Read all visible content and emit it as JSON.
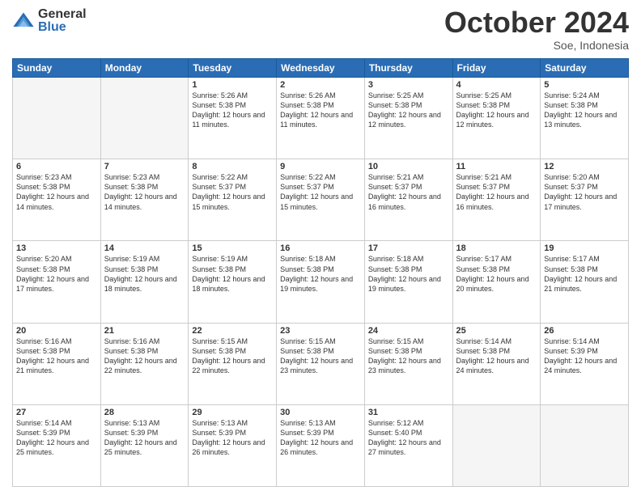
{
  "logo": {
    "general": "General",
    "blue": "Blue"
  },
  "header": {
    "month": "October 2024",
    "location": "Soe, Indonesia"
  },
  "weekdays": [
    "Sunday",
    "Monday",
    "Tuesday",
    "Wednesday",
    "Thursday",
    "Friday",
    "Saturday"
  ],
  "weeks": [
    [
      {
        "day": "",
        "info": ""
      },
      {
        "day": "",
        "info": ""
      },
      {
        "day": "1",
        "info": "Sunrise: 5:26 AM\nSunset: 5:38 PM\nDaylight: 12 hours and 11 minutes."
      },
      {
        "day": "2",
        "info": "Sunrise: 5:26 AM\nSunset: 5:38 PM\nDaylight: 12 hours and 11 minutes."
      },
      {
        "day": "3",
        "info": "Sunrise: 5:25 AM\nSunset: 5:38 PM\nDaylight: 12 hours and 12 minutes."
      },
      {
        "day": "4",
        "info": "Sunrise: 5:25 AM\nSunset: 5:38 PM\nDaylight: 12 hours and 12 minutes."
      },
      {
        "day": "5",
        "info": "Sunrise: 5:24 AM\nSunset: 5:38 PM\nDaylight: 12 hours and 13 minutes."
      }
    ],
    [
      {
        "day": "6",
        "info": "Sunrise: 5:23 AM\nSunset: 5:38 PM\nDaylight: 12 hours and 14 minutes."
      },
      {
        "day": "7",
        "info": "Sunrise: 5:23 AM\nSunset: 5:38 PM\nDaylight: 12 hours and 14 minutes."
      },
      {
        "day": "8",
        "info": "Sunrise: 5:22 AM\nSunset: 5:37 PM\nDaylight: 12 hours and 15 minutes."
      },
      {
        "day": "9",
        "info": "Sunrise: 5:22 AM\nSunset: 5:37 PM\nDaylight: 12 hours and 15 minutes."
      },
      {
        "day": "10",
        "info": "Sunrise: 5:21 AM\nSunset: 5:37 PM\nDaylight: 12 hours and 16 minutes."
      },
      {
        "day": "11",
        "info": "Sunrise: 5:21 AM\nSunset: 5:37 PM\nDaylight: 12 hours and 16 minutes."
      },
      {
        "day": "12",
        "info": "Sunrise: 5:20 AM\nSunset: 5:37 PM\nDaylight: 12 hours and 17 minutes."
      }
    ],
    [
      {
        "day": "13",
        "info": "Sunrise: 5:20 AM\nSunset: 5:38 PM\nDaylight: 12 hours and 17 minutes."
      },
      {
        "day": "14",
        "info": "Sunrise: 5:19 AM\nSunset: 5:38 PM\nDaylight: 12 hours and 18 minutes."
      },
      {
        "day": "15",
        "info": "Sunrise: 5:19 AM\nSunset: 5:38 PM\nDaylight: 12 hours and 18 minutes."
      },
      {
        "day": "16",
        "info": "Sunrise: 5:18 AM\nSunset: 5:38 PM\nDaylight: 12 hours and 19 minutes."
      },
      {
        "day": "17",
        "info": "Sunrise: 5:18 AM\nSunset: 5:38 PM\nDaylight: 12 hours and 19 minutes."
      },
      {
        "day": "18",
        "info": "Sunrise: 5:17 AM\nSunset: 5:38 PM\nDaylight: 12 hours and 20 minutes."
      },
      {
        "day": "19",
        "info": "Sunrise: 5:17 AM\nSunset: 5:38 PM\nDaylight: 12 hours and 21 minutes."
      }
    ],
    [
      {
        "day": "20",
        "info": "Sunrise: 5:16 AM\nSunset: 5:38 PM\nDaylight: 12 hours and 21 minutes."
      },
      {
        "day": "21",
        "info": "Sunrise: 5:16 AM\nSunset: 5:38 PM\nDaylight: 12 hours and 22 minutes."
      },
      {
        "day": "22",
        "info": "Sunrise: 5:15 AM\nSunset: 5:38 PM\nDaylight: 12 hours and 22 minutes."
      },
      {
        "day": "23",
        "info": "Sunrise: 5:15 AM\nSunset: 5:38 PM\nDaylight: 12 hours and 23 minutes."
      },
      {
        "day": "24",
        "info": "Sunrise: 5:15 AM\nSunset: 5:38 PM\nDaylight: 12 hours and 23 minutes."
      },
      {
        "day": "25",
        "info": "Sunrise: 5:14 AM\nSunset: 5:38 PM\nDaylight: 12 hours and 24 minutes."
      },
      {
        "day": "26",
        "info": "Sunrise: 5:14 AM\nSunset: 5:39 PM\nDaylight: 12 hours and 24 minutes."
      }
    ],
    [
      {
        "day": "27",
        "info": "Sunrise: 5:14 AM\nSunset: 5:39 PM\nDaylight: 12 hours and 25 minutes."
      },
      {
        "day": "28",
        "info": "Sunrise: 5:13 AM\nSunset: 5:39 PM\nDaylight: 12 hours and 25 minutes."
      },
      {
        "day": "29",
        "info": "Sunrise: 5:13 AM\nSunset: 5:39 PM\nDaylight: 12 hours and 26 minutes."
      },
      {
        "day": "30",
        "info": "Sunrise: 5:13 AM\nSunset: 5:39 PM\nDaylight: 12 hours and 26 minutes."
      },
      {
        "day": "31",
        "info": "Sunrise: 5:12 AM\nSunset: 5:40 PM\nDaylight: 12 hours and 27 minutes."
      },
      {
        "day": "",
        "info": ""
      },
      {
        "day": "",
        "info": ""
      }
    ]
  ]
}
